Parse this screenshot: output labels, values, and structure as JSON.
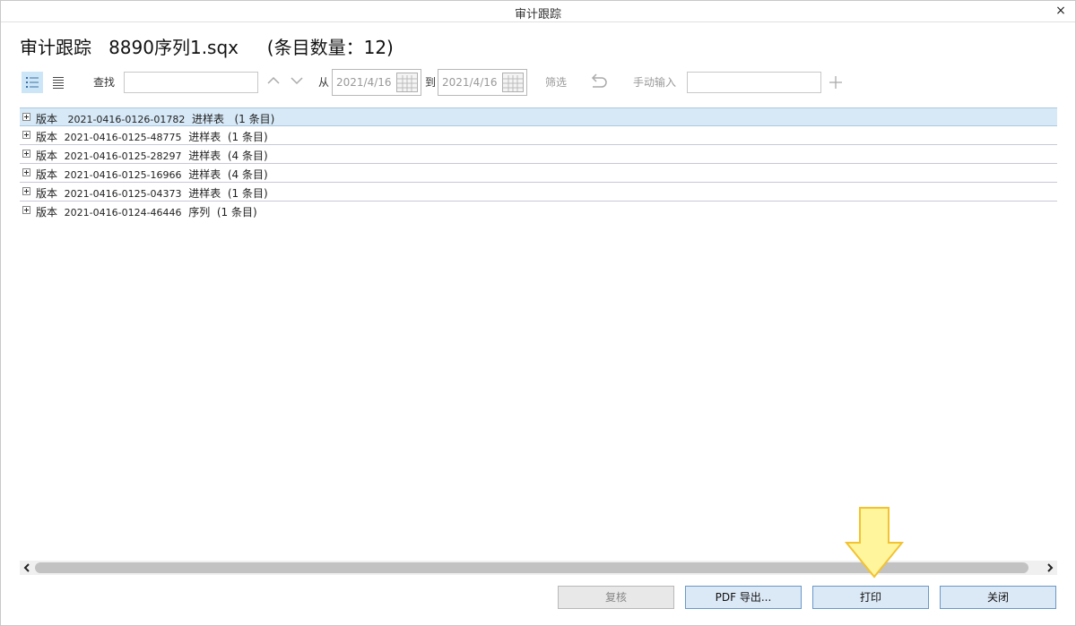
{
  "window": {
    "title": "审计跟踪",
    "close_glyph": "×"
  },
  "heading": "审计跟踪   8890序列1.sqx     (条目数量：12)",
  "toolbar": {
    "view_tree_icon": "list-tree-icon",
    "view_flat_icon": "list-flat-icon",
    "find_label": "查找",
    "find_value": "",
    "from_label": "从",
    "from_date": "2021/4/16",
    "to_label": "到",
    "to_date": "2021/4/16",
    "filter_label": "筛选",
    "manual_label": "手动输入",
    "manual_value": ""
  },
  "tree": [
    {
      "prefix": "版本",
      "version": "2021-0416-0126-01782",
      "type": "进样表",
      "count": "(1 条目)",
      "selected": true
    },
    {
      "prefix": "版本",
      "version": "2021-0416-0125-48775",
      "type": "进样表",
      "count": "(1 条目)",
      "selected": false
    },
    {
      "prefix": "版本",
      "version": "2021-0416-0125-28297",
      "type": "进样表",
      "count": "(4 条目)",
      "selected": false
    },
    {
      "prefix": "版本",
      "version": "2021-0416-0125-16966",
      "type": "进样表",
      "count": "(4 条目)",
      "selected": false
    },
    {
      "prefix": "版本",
      "version": "2021-0416-0125-04373",
      "type": "进样表",
      "count": "(1 条目)",
      "selected": false
    },
    {
      "prefix": "版本",
      "version": "2021-0416-0124-46446",
      "type": "序列",
      "count": "(1 条目)",
      "selected": false
    }
  ],
  "buttons": {
    "review": "复核",
    "pdf_export": "PDF 导出...",
    "print": "打印",
    "close": "关闭"
  },
  "colors": {
    "selected_row": "#d7e9f7",
    "button_bg": "#dbe8f5",
    "annotation_arrow": "#fff59d"
  }
}
